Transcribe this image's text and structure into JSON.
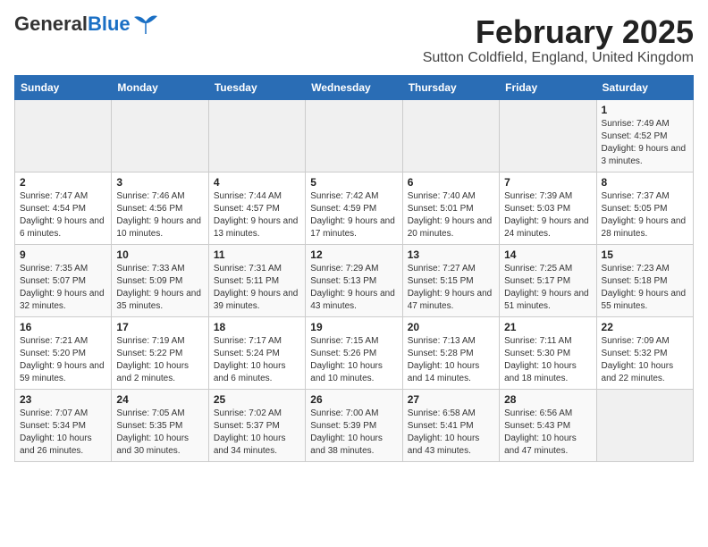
{
  "header": {
    "logo_general": "General",
    "logo_blue": "Blue",
    "month_year": "February 2025",
    "location": "Sutton Coldfield, England, United Kingdom"
  },
  "weekdays": [
    "Sunday",
    "Monday",
    "Tuesday",
    "Wednesday",
    "Thursday",
    "Friday",
    "Saturday"
  ],
  "weeks": [
    [
      {
        "day": "",
        "info": ""
      },
      {
        "day": "",
        "info": ""
      },
      {
        "day": "",
        "info": ""
      },
      {
        "day": "",
        "info": ""
      },
      {
        "day": "",
        "info": ""
      },
      {
        "day": "",
        "info": ""
      },
      {
        "day": "1",
        "info": "Sunrise: 7:49 AM\nSunset: 4:52 PM\nDaylight: 9 hours and 3 minutes."
      }
    ],
    [
      {
        "day": "2",
        "info": "Sunrise: 7:47 AM\nSunset: 4:54 PM\nDaylight: 9 hours and 6 minutes."
      },
      {
        "day": "3",
        "info": "Sunrise: 7:46 AM\nSunset: 4:56 PM\nDaylight: 9 hours and 10 minutes."
      },
      {
        "day": "4",
        "info": "Sunrise: 7:44 AM\nSunset: 4:57 PM\nDaylight: 9 hours and 13 minutes."
      },
      {
        "day": "5",
        "info": "Sunrise: 7:42 AM\nSunset: 4:59 PM\nDaylight: 9 hours and 17 minutes."
      },
      {
        "day": "6",
        "info": "Sunrise: 7:40 AM\nSunset: 5:01 PM\nDaylight: 9 hours and 20 minutes."
      },
      {
        "day": "7",
        "info": "Sunrise: 7:39 AM\nSunset: 5:03 PM\nDaylight: 9 hours and 24 minutes."
      },
      {
        "day": "8",
        "info": "Sunrise: 7:37 AM\nSunset: 5:05 PM\nDaylight: 9 hours and 28 minutes."
      }
    ],
    [
      {
        "day": "9",
        "info": "Sunrise: 7:35 AM\nSunset: 5:07 PM\nDaylight: 9 hours and 32 minutes."
      },
      {
        "day": "10",
        "info": "Sunrise: 7:33 AM\nSunset: 5:09 PM\nDaylight: 9 hours and 35 minutes."
      },
      {
        "day": "11",
        "info": "Sunrise: 7:31 AM\nSunset: 5:11 PM\nDaylight: 9 hours and 39 minutes."
      },
      {
        "day": "12",
        "info": "Sunrise: 7:29 AM\nSunset: 5:13 PM\nDaylight: 9 hours and 43 minutes."
      },
      {
        "day": "13",
        "info": "Sunrise: 7:27 AM\nSunset: 5:15 PM\nDaylight: 9 hours and 47 minutes."
      },
      {
        "day": "14",
        "info": "Sunrise: 7:25 AM\nSunset: 5:17 PM\nDaylight: 9 hours and 51 minutes."
      },
      {
        "day": "15",
        "info": "Sunrise: 7:23 AM\nSunset: 5:18 PM\nDaylight: 9 hours and 55 minutes."
      }
    ],
    [
      {
        "day": "16",
        "info": "Sunrise: 7:21 AM\nSunset: 5:20 PM\nDaylight: 9 hours and 59 minutes."
      },
      {
        "day": "17",
        "info": "Sunrise: 7:19 AM\nSunset: 5:22 PM\nDaylight: 10 hours and 2 minutes."
      },
      {
        "day": "18",
        "info": "Sunrise: 7:17 AM\nSunset: 5:24 PM\nDaylight: 10 hours and 6 minutes."
      },
      {
        "day": "19",
        "info": "Sunrise: 7:15 AM\nSunset: 5:26 PM\nDaylight: 10 hours and 10 minutes."
      },
      {
        "day": "20",
        "info": "Sunrise: 7:13 AM\nSunset: 5:28 PM\nDaylight: 10 hours and 14 minutes."
      },
      {
        "day": "21",
        "info": "Sunrise: 7:11 AM\nSunset: 5:30 PM\nDaylight: 10 hours and 18 minutes."
      },
      {
        "day": "22",
        "info": "Sunrise: 7:09 AM\nSunset: 5:32 PM\nDaylight: 10 hours and 22 minutes."
      }
    ],
    [
      {
        "day": "23",
        "info": "Sunrise: 7:07 AM\nSunset: 5:34 PM\nDaylight: 10 hours and 26 minutes."
      },
      {
        "day": "24",
        "info": "Sunrise: 7:05 AM\nSunset: 5:35 PM\nDaylight: 10 hours and 30 minutes."
      },
      {
        "day": "25",
        "info": "Sunrise: 7:02 AM\nSunset: 5:37 PM\nDaylight: 10 hours and 34 minutes."
      },
      {
        "day": "26",
        "info": "Sunrise: 7:00 AM\nSunset: 5:39 PM\nDaylight: 10 hours and 38 minutes."
      },
      {
        "day": "27",
        "info": "Sunrise: 6:58 AM\nSunset: 5:41 PM\nDaylight: 10 hours and 43 minutes."
      },
      {
        "day": "28",
        "info": "Sunrise: 6:56 AM\nSunset: 5:43 PM\nDaylight: 10 hours and 47 minutes."
      },
      {
        "day": "",
        "info": ""
      }
    ]
  ]
}
